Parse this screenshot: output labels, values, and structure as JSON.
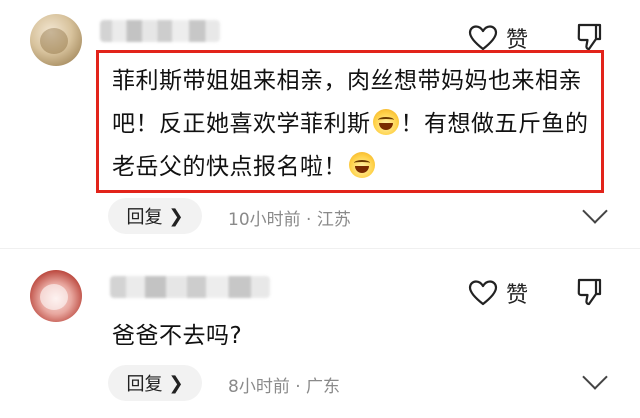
{
  "comments": [
    {
      "like_label": "赞",
      "text_parts": [
        "菲利斯带姐姐来相亲，肉丝想带妈妈也来相亲吧！反正她喜欢学菲利斯",
        "！有想做五斤鱼的老岳父的快点报名啦！"
      ],
      "emoji_icon": "laughing-tears-emoji",
      "reply_label": "回复",
      "meta": "10小时前 · 江苏"
    },
    {
      "like_label": "赞",
      "text": "爸爸不去吗?",
      "reply_label": "回复",
      "meta": "8小时前 · 广东"
    }
  ],
  "colors": {
    "highlight_border": "#e2231a",
    "reply_pill_bg": "#f2f2f2",
    "meta_text": "#8a8a8a"
  }
}
